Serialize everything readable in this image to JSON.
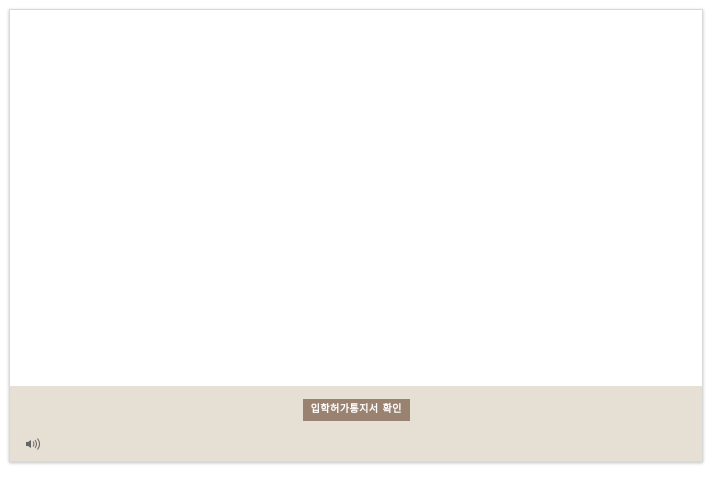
{
  "footer": {
    "confirm_button_label": "입학허가통지서 확인",
    "sound_icon": "speaker-icon"
  },
  "colors": {
    "footer_background": "#e6dfd4",
    "button_background": "#9a8271",
    "button_text": "#ffffff",
    "frame_border": "#d9d9d9"
  }
}
